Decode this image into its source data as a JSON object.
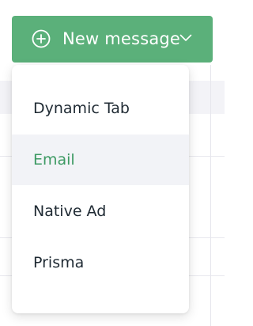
{
  "button": {
    "label": "New message",
    "icon": "plus-circle-icon",
    "dropdown_icon": "chevron-down-icon",
    "color": "#5bb07a"
  },
  "menu": {
    "items": [
      {
        "label": "Dynamic Tab",
        "active": false
      },
      {
        "label": "Email",
        "active": true
      },
      {
        "label": "Native Ad",
        "active": false
      },
      {
        "label": "Prisma",
        "active": false
      }
    ],
    "active_color": "#3d9a63"
  }
}
